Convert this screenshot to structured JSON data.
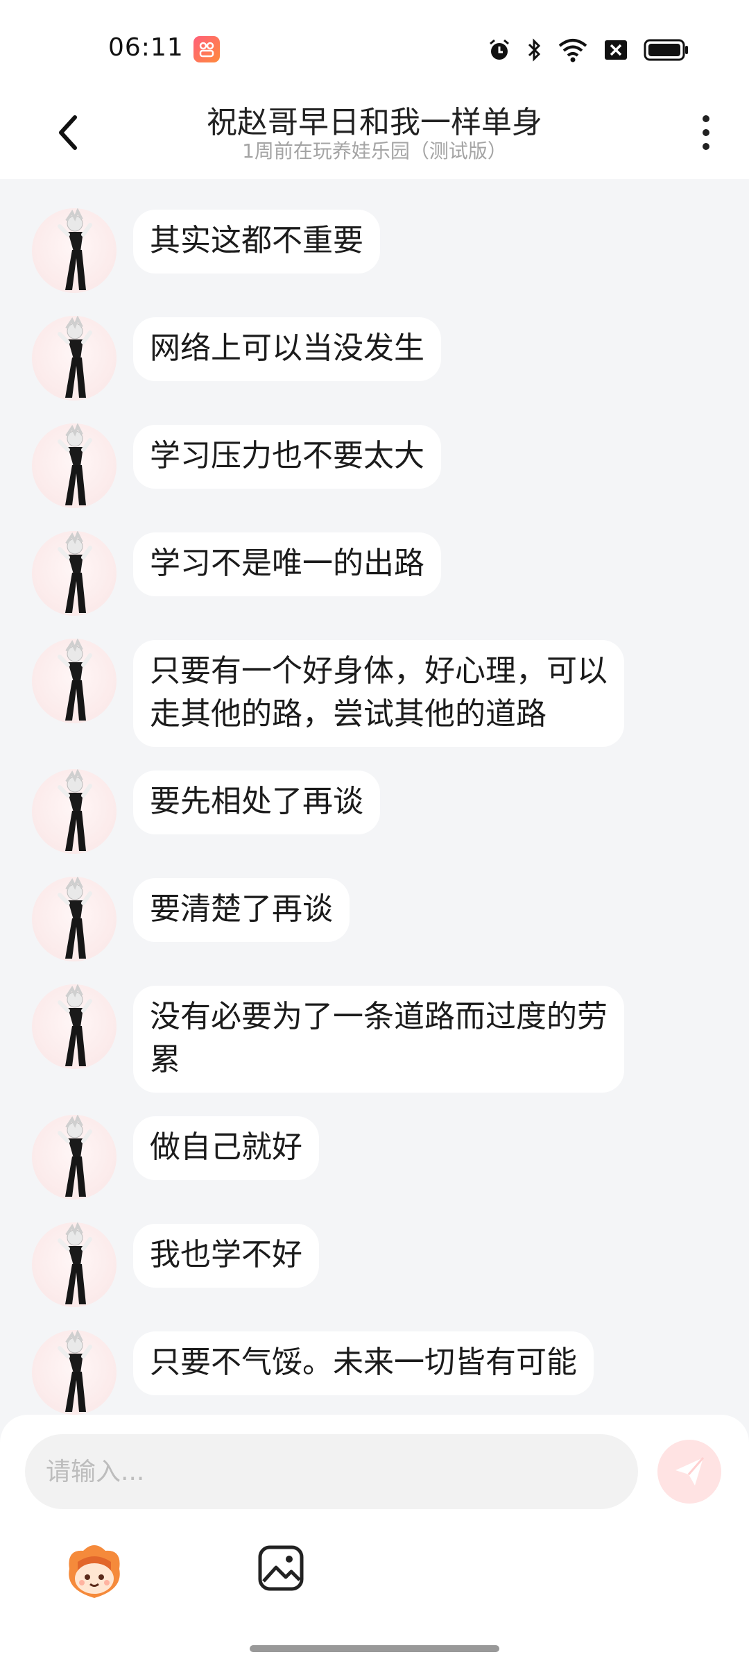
{
  "status_bar": {
    "time": "06:11"
  },
  "header": {
    "title": "祝赵哥早日和我一样单身",
    "subtitle": "1周前在玩养娃乐园（测试版）"
  },
  "messages": [
    {
      "text": "其实这都不重要"
    },
    {
      "text": "网络上可以当没发生"
    },
    {
      "text": "学习压力也不要太大"
    },
    {
      "text": "学习不是唯一的出路"
    },
    {
      "text": "只要有一个好身体，好心理，可以走其他的路，尝试其他的道路"
    },
    {
      "text": "要先相处了再谈"
    },
    {
      "text": "要清楚了再谈"
    },
    {
      "text": "没有必要为了一条道路而过度的劳累"
    },
    {
      "text": "做自己就好"
    },
    {
      "text": "我也学不好"
    },
    {
      "text": "只要不气馁。未来一切皆有可能"
    }
  ],
  "input": {
    "placeholder": "请输入..."
  },
  "icons": {
    "back": "chevron-left-icon",
    "more": "more-vertical-icon",
    "send": "paper-plane-icon",
    "mascot": "mascot-emoji-icon",
    "image": "image-icon"
  },
  "colors": {
    "background": "#f4f5f7",
    "bubble": "#ffffff",
    "send_button": "#ffe3e3",
    "send_icon": "#ffffff"
  }
}
